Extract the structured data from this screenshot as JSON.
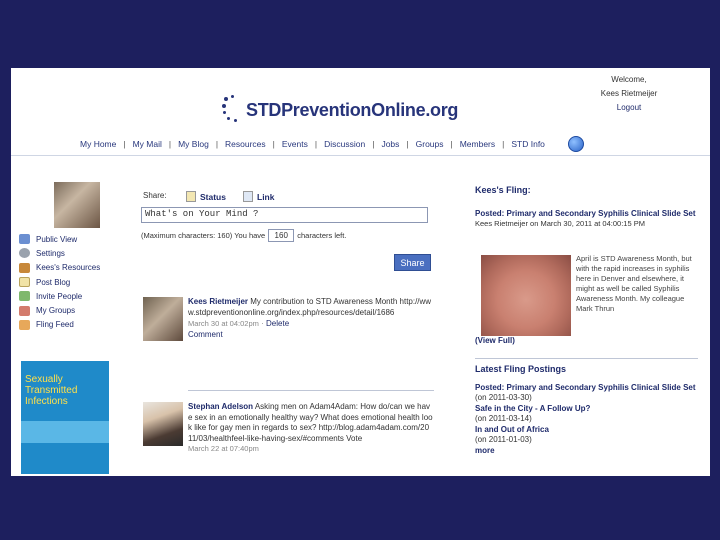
{
  "header": {
    "welcome": "Welcome,",
    "user": "Kees Rietmeijer",
    "logout": "Logout",
    "logo": "STDPreventionOnline.org"
  },
  "nav": [
    "My Home",
    "My Mail",
    "My Blog",
    "Resources",
    "Events",
    "Discussion",
    "Jobs",
    "Groups",
    "Members",
    "STD Info"
  ],
  "sidebar": {
    "items": [
      "Public View",
      "Settings",
      "Kees's Resources",
      "Post Blog",
      "Invite People",
      "My Groups",
      "Fling Feed"
    ]
  },
  "book": {
    "title_line1": "Sexually",
    "title_line2": "Transmitted",
    "title_line3": "Infections"
  },
  "share": {
    "label": "Share:",
    "tab_status": "Status",
    "tab_link": "Link",
    "input_value": "What's on Your Mind ?",
    "max_prefix": "(Maximum characters: 160) You have",
    "count": "160",
    "max_suffix": "characters left.",
    "button": "Share"
  },
  "posts": [
    {
      "author": "Kees Rietmeijer",
      "text": "My contribution to STD Awareness Month http://www.stdpreventiononline.org/index.php/resources/detail/1686",
      "meta": "March 30 at 04:02pm",
      "delete": "Delete",
      "comment": "Comment"
    },
    {
      "author": "Stephan Adelson",
      "text": "Asking men on Adam4Adam: How do/can we have sex in an emotionally healthy way? What does emotional health look like for gay men in regards to sex? http://blog.adam4adam.com/2011/03/healthfeel-like-having-sex/#comments Vote",
      "meta": "March 22 at 07:40pm"
    }
  ],
  "right": {
    "fling_title": "Kees's Fling:",
    "posted_title": "Posted: Primary and Secondary Syphilis Clinical Slide Set",
    "posted_meta": "Kees Rietmeijer on March 30, 2011 at 04:00:15 PM",
    "caption": "April is STD Awareness Month, but with the rapid increases in syphilis here in Denver and elsewhere, it might as well be called Syphilis Awareness Month. My colleague Mark Thrun",
    "view_full": "(View Full)",
    "latest_title": "Latest Fling Postings",
    "latest": [
      {
        "title": "Posted: Primary and Secondary Syphilis Clinical Slide Set",
        "date": "(on 2011-03-30)"
      },
      {
        "title": "Safe in the City - A Follow Up?",
        "date": "(on 2011-03-14)"
      },
      {
        "title": "In and Out of Africa",
        "date": "(on 2011-01-03)"
      }
    ],
    "more": "more"
  }
}
